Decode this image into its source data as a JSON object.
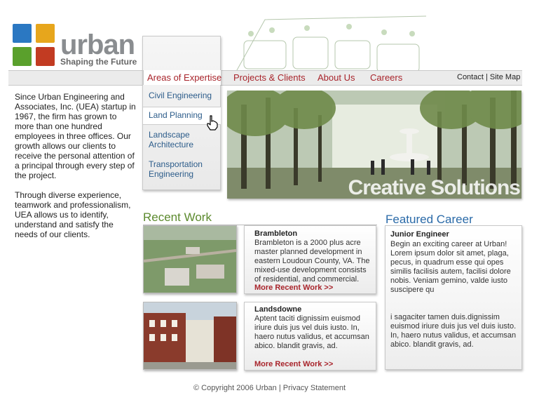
{
  "brand": {
    "name": "urban",
    "tagline": "Shaping the Future",
    "colors": {
      "blue": "#2b78c2",
      "yellow": "#e7a61c",
      "green": "#5aa02c",
      "red": "#c23b22"
    }
  },
  "nav": {
    "items": [
      "Areas of Expertise",
      "Projects & Clients",
      "About Us",
      "Careers"
    ],
    "util": {
      "contact": "Contact",
      "sep": "|",
      "sitemap": "Site Map"
    }
  },
  "dropdown": {
    "items": [
      "Civil Engineering",
      "Land Planning",
      "Landscape Architecture",
      "Transportation Engineering"
    ]
  },
  "intro": {
    "p1": "Since Urban Engineering and Associates, Inc. (UEA) startup in 1967, the firm has grown to more than one hundred employees in three offices. Our growth allows our clients to receive the personal attention of a principal through every step of the project.",
    "p2": "Through diverse experience, teamwork and professionalism, UEA allows us to identify, understand and satisfy the needs of our clients."
  },
  "hero": {
    "caption": "Creative Solutions"
  },
  "recent": {
    "heading": "Recent Work",
    "cards": [
      {
        "title": "Brambleton",
        "body": "Brambleton is a 2000 plus acre master planned development in eastern Loudoun County, VA. The mixed-use development consists of residential, and commercial.",
        "link": "More Recent Work >>"
      },
      {
        "title": "Landsdowne",
        "body": "Aptent taciti dignissim euismod iriure duis jus vel duis iusto. In, haero nutus validus, et accumsan abico. blandit gravis, ad.",
        "link": "More Recent Work >>"
      }
    ]
  },
  "career": {
    "heading": "Featured Career",
    "title": "Junior Engineer",
    "p1": "Begin an exciting career at Urban! Lorem ipsum dolor sit amet, plaga, pecus, in quadrum esse qui opes similis facilisis autem, facilisi dolore nobis. Veniam gemino, valde iusto suscipere qu",
    "p2": "i sagaciter tamen duis.dignissim euismod iriure duis jus vel duis iusto. In, haero nutus validus, et accumsan abico. blandit gravis, ad."
  },
  "footer": {
    "copyright": "© Copyright 2006 Urban",
    "sep": "|",
    "privacy": "Privacy Statement"
  }
}
